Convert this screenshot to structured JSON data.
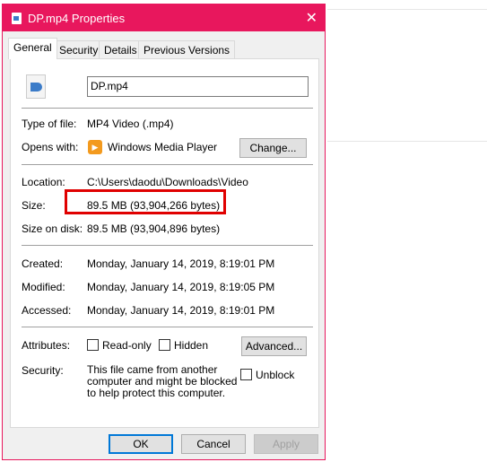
{
  "window": {
    "title": "DP.mp4 Properties",
    "accent": "#e8175d"
  },
  "tabs": [
    {
      "label": "General"
    },
    {
      "label": "Security"
    },
    {
      "label": "Details"
    },
    {
      "label": "Previous Versions"
    }
  ],
  "file_name": "DP.mp4",
  "fields": {
    "type_label": "Type of file:",
    "type_value": "MP4 Video (.mp4)",
    "opens_label": "Opens with:",
    "opens_value": "Windows Media Player",
    "change_button": "Change...",
    "location_label": "Location:",
    "location_value": "C:\\Users\\daodu\\Downloads\\Video",
    "size_label": "Size:",
    "size_value": "89.5 MB (93,904,266 bytes)",
    "disk_label": "Size on disk:",
    "disk_value": "89.5 MB (93,904,896 bytes)",
    "created_label": "Created:",
    "created_value": "Monday, January 14, 2019, 8:19:01 PM",
    "modified_label": "Modified:",
    "modified_value": "Monday, January 14, 2019, 8:19:05 PM",
    "accessed_label": "Accessed:",
    "accessed_value": "Monday, January 14, 2019, 8:19:01 PM",
    "attributes_label": "Attributes:",
    "readonly": "Read-only",
    "hidden": "Hidden",
    "advanced_button": "Advanced...",
    "security_label": "Security:",
    "security_text": "This file came from another computer and might be blocked to help protect this computer.",
    "unblock": "Unblock"
  },
  "buttons": {
    "ok": "OK",
    "cancel": "Cancel",
    "apply": "Apply"
  },
  "highlight_color": "#e00000"
}
